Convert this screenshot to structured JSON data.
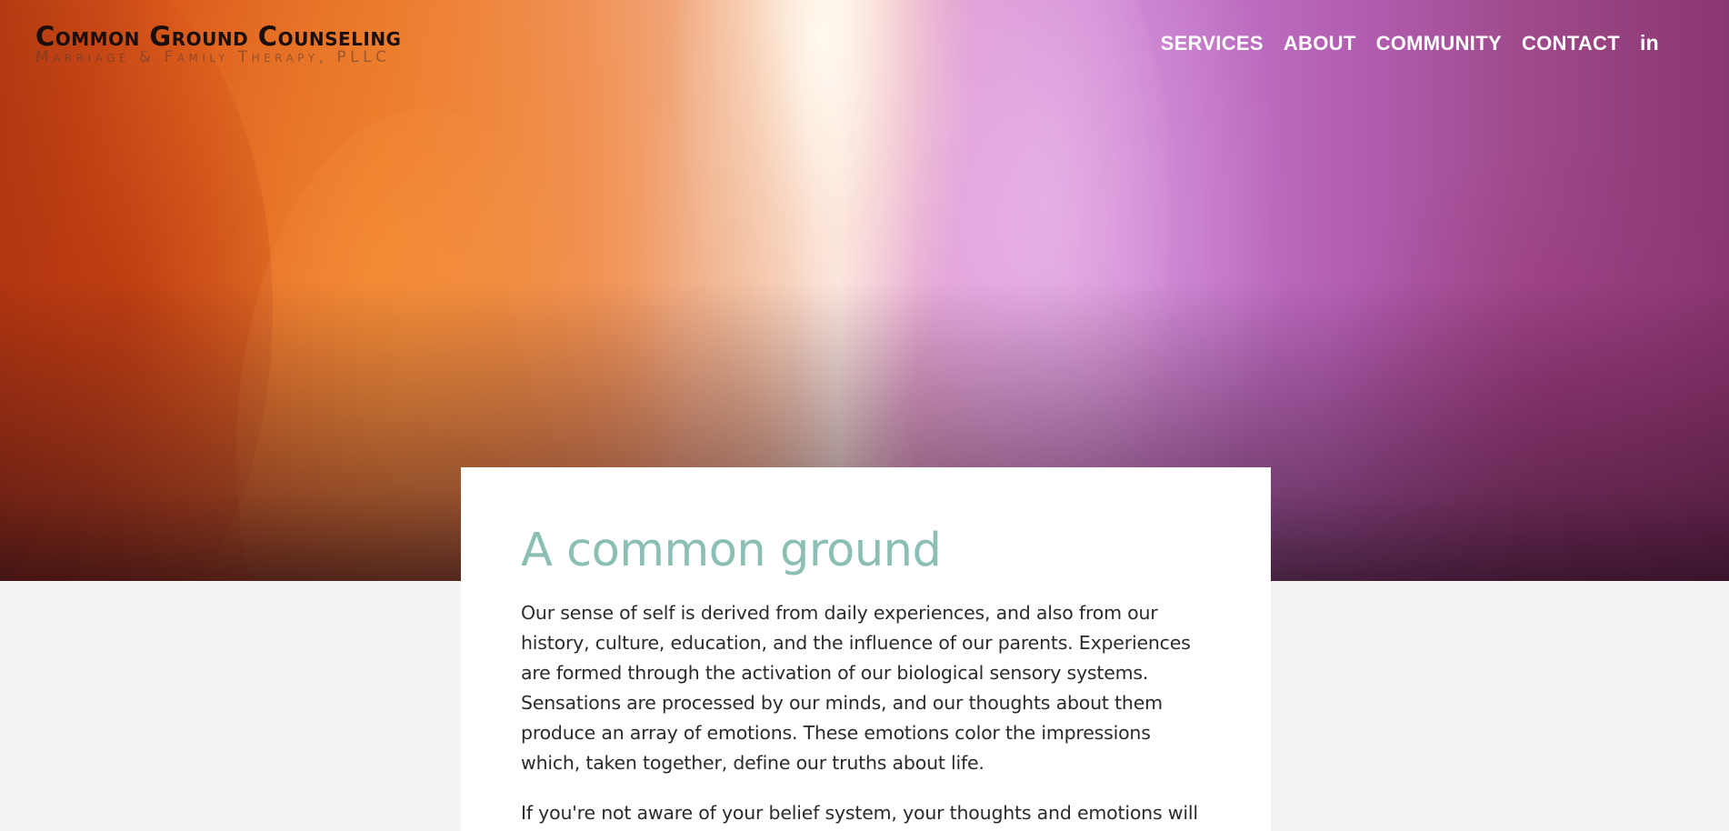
{
  "brand": {
    "title": "Common Ground Counseling",
    "subtitle": "Marriage & Family Therapy, PLLC"
  },
  "nav": {
    "items": [
      {
        "label": "SERVICES"
      },
      {
        "label": "ABOUT"
      },
      {
        "label": "COMMUNITY"
      },
      {
        "label": "CONTACT"
      }
    ],
    "linkedin_label": "in",
    "linkedin_icon": "linkedin-icon"
  },
  "content": {
    "heading": "A common ground",
    "paragraphs": [
      "Our sense of self is derived from daily experiences, and also from our history, culture, education, and the influence of our parents. Experiences are formed through the activation of our biological sensory systems. Sensations are processed by our minds, and our thoughts about them produce an array of emotions. These emotions color the impressions which, taken together, define our truths about life.",
      "If you're not aware of your belief system, your thoughts and emotions will wear"
    ]
  },
  "colors": {
    "heading": "#8bbfb3",
    "page_bg": "#f3f3f1",
    "card_bg": "#ffffff",
    "nav_text": "#ffffff"
  }
}
